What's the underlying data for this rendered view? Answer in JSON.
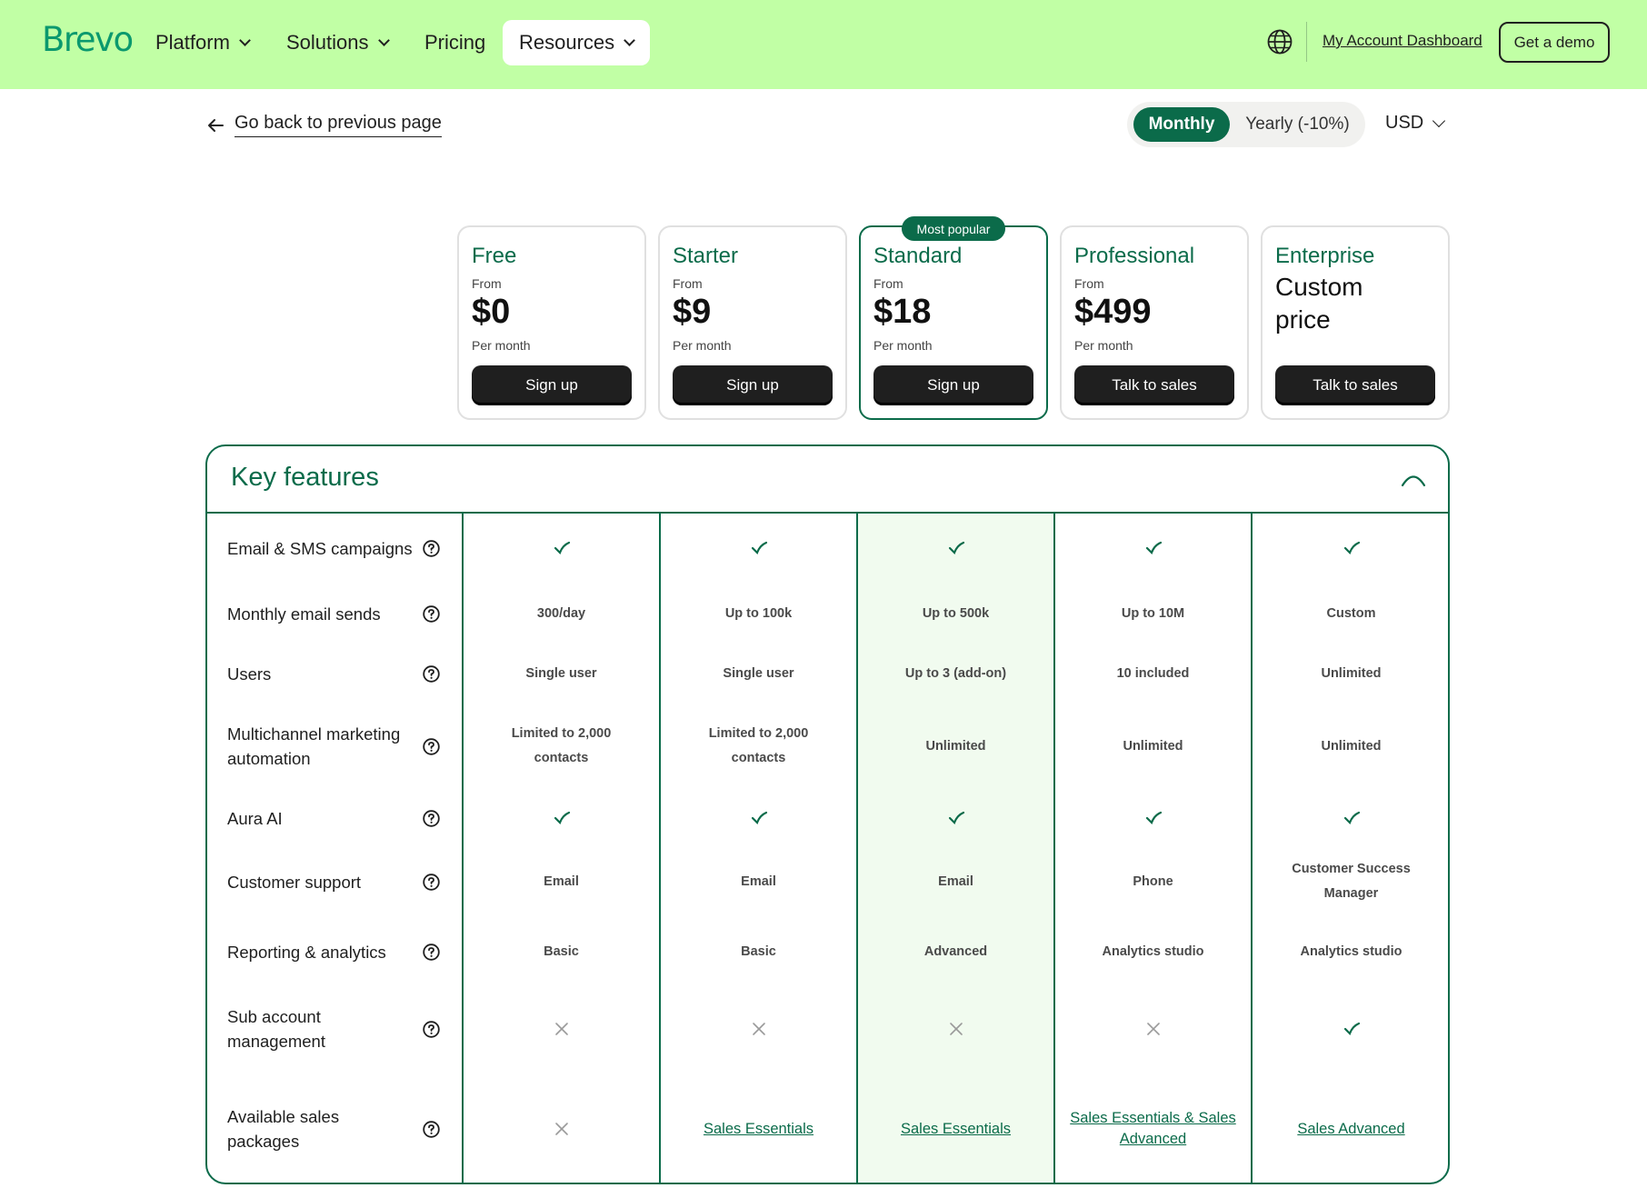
{
  "header": {
    "logo": "Brevo",
    "nav": [
      {
        "label": "Platform",
        "has_dropdown": true
      },
      {
        "label": "Solutions",
        "has_dropdown": true
      },
      {
        "label": "Pricing",
        "has_dropdown": false
      },
      {
        "label": "Resources",
        "has_dropdown": true,
        "active": true
      }
    ],
    "globe_icon": "globe-icon",
    "account_link": "My Account Dashboard",
    "demo_button": "Get a demo",
    "background_color": "#c1ffa5"
  },
  "subbar": {
    "back_link": "Go back to previous page",
    "billing": {
      "monthly": "Monthly",
      "yearly": "Yearly (-10%)",
      "selected": "Monthly"
    },
    "currency": "USD"
  },
  "plans": [
    {
      "name": "Free",
      "from": "From",
      "price": "$0",
      "period": "Per month",
      "cta": "Sign up"
    },
    {
      "name": "Starter",
      "from": "From",
      "price": "$9",
      "period": "Per month",
      "cta": "Sign up"
    },
    {
      "name": "Standard",
      "badge": "Most popular",
      "from": "From",
      "price": "$18",
      "period": "Per month",
      "cta": "Sign up"
    },
    {
      "name": "Professional",
      "from": "From",
      "price": "$499",
      "period": "Per month",
      "cta": "Talk to sales"
    },
    {
      "name": "Enterprise",
      "custom": "Custom price",
      "cta": "Talk to sales"
    }
  ],
  "features": {
    "title": "Key features",
    "rows": [
      {
        "label": "Email & SMS campaigns",
        "values": [
          "check",
          "check",
          "check",
          "check",
          "check"
        ]
      },
      {
        "label": "Monthly email sends",
        "values": [
          "300/day",
          "Up to 100k",
          "Up to 500k",
          "Up to 10M",
          "Custom"
        ]
      },
      {
        "label": "Users",
        "values": [
          "Single user",
          "Single user",
          "Up to 3 (add-on)",
          "10 included",
          "Unlimited"
        ]
      },
      {
        "label": "Multichannel marketing automation",
        "values": [
          "Limited to 2,000 contacts",
          "Limited to 2,000 contacts",
          "Unlimited",
          "Unlimited",
          "Unlimited"
        ]
      },
      {
        "label": "Aura AI",
        "values": [
          "check",
          "check",
          "check",
          "check",
          "check"
        ]
      },
      {
        "label": "Customer support",
        "values": [
          "Email",
          "Email",
          "Email",
          "Phone",
          "Customer Success Manager"
        ]
      },
      {
        "label": "Reporting & analytics",
        "values": [
          "Basic",
          "Basic",
          "Advanced",
          "Analytics studio",
          "Analytics studio"
        ]
      },
      {
        "label": "Sub account management",
        "values": [
          "cross",
          "cross",
          "cross",
          "cross",
          "check"
        ]
      },
      {
        "label": "Available sales packages",
        "values": [
          "cross",
          "link:Sales Essentials",
          "link:Sales Essentials",
          "link:Sales Essentials & Sales Advanced",
          "link:Sales Advanced"
        ]
      }
    ]
  },
  "colors": {
    "brand_green": "#0b6b4a",
    "logo_green": "#0b996e",
    "highlight": "#f1fbef"
  }
}
